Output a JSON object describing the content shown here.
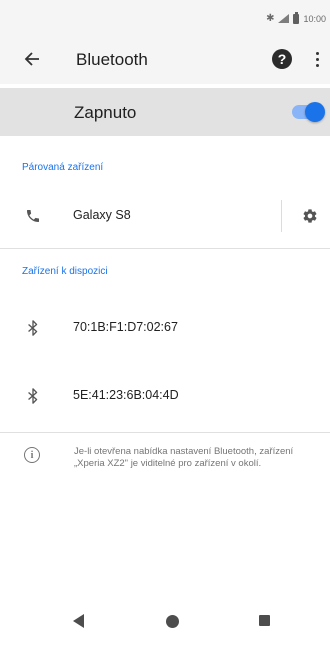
{
  "status_bar": {
    "time": "10:00",
    "icons": [
      "bluetooth-icon",
      "signal-icon",
      "battery-icon"
    ]
  },
  "toolbar": {
    "title": "Bluetooth",
    "back_icon": "arrow-back-icon",
    "help_icon": "help-icon",
    "help_glyph": "?",
    "more_icon": "more-vert-icon"
  },
  "master_switch": {
    "label": "Zapnuto",
    "enabled": true
  },
  "paired": {
    "header": "Párovaná zařízení",
    "devices": [
      {
        "name": "Galaxy S8",
        "icon": "phone-icon",
        "settings_icon": "gear-icon"
      }
    ]
  },
  "available": {
    "header": "Zařízení k dispozici",
    "devices": [
      {
        "name": "70:1B:F1:D7:02:67",
        "icon": "bluetooth-icon"
      },
      {
        "name": "5E:41:23:6B:04:4D",
        "icon": "bluetooth-icon"
      }
    ]
  },
  "info": {
    "icon": "info-icon",
    "glyph": "i",
    "text": "Je-li otevřena nabídka nastavení Bluetooth, zařízení „Xperia XZ2\" je viditelné pro zařízení v okolí."
  },
  "navigation": {
    "items": [
      "back-nav-button",
      "home-nav-button",
      "recents-nav-button"
    ]
  },
  "colors": {
    "accent": "#1a73e8",
    "toggle_track": "#8ab4f8",
    "toolbar_bg": "#f5f5f5",
    "switch_bar_bg": "#e2e2e2"
  }
}
